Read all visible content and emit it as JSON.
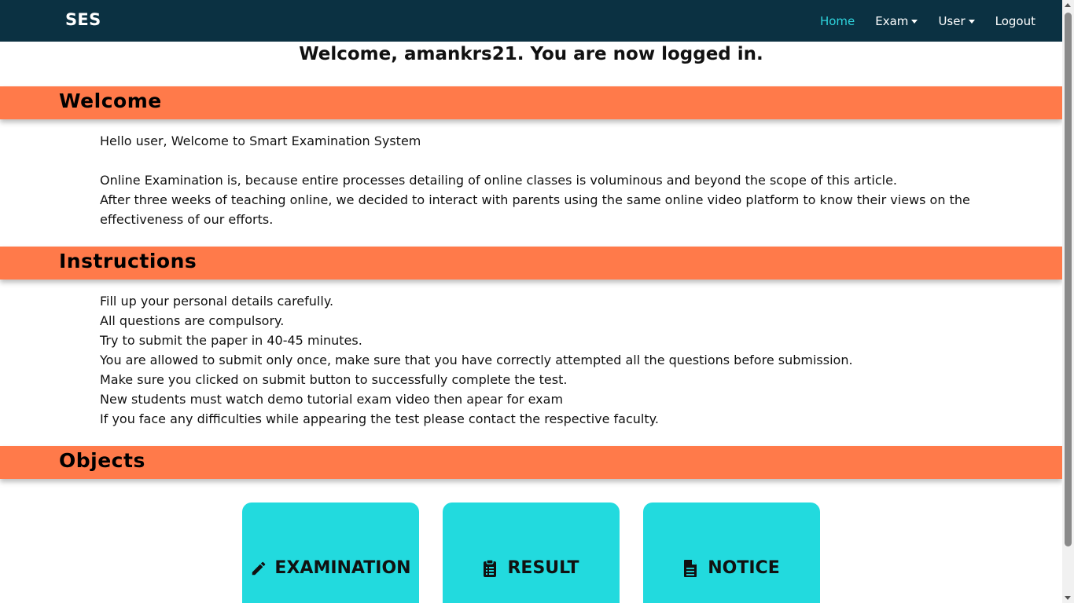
{
  "navbar": {
    "brand": "SES",
    "links": [
      {
        "label": "Home",
        "active": true
      },
      {
        "label": "Exam",
        "dropdown": true
      },
      {
        "label": "User",
        "dropdown": true
      },
      {
        "label": "Logout"
      }
    ]
  },
  "welcome_message": "Welcome, amankrs21. You are now logged in.",
  "sections": {
    "welcome": {
      "title": "Welcome",
      "lines": [
        "Hello user, Welcome to Smart Examination System",
        "",
        "Online Examination is, because entire processes detailing of online classes is voluminous and beyond the scope of this article.",
        "After three weeks of teaching online, we decided to interact with parents using the same online video platform to know their views on the effectiveness of our efforts."
      ]
    },
    "instructions": {
      "title": "Instructions",
      "lines": [
        "Fill up your personal details carefully.",
        "All questions are compulsory.",
        "Try to submit the paper in 40-45 minutes.",
        "You are allowed to submit only once, make sure that you have correctly attempted all the questions before submission.",
        "Make sure you clicked on submit button to successfully complete the test.",
        "New students must watch demo tutorial exam video then apear for exam",
        "If you face any difficulties while appearing the test please contact the respective faculty."
      ]
    },
    "objects": {
      "title": "Objects"
    }
  },
  "cards": [
    {
      "label": "EXAMINATION",
      "icon": "pencil-icon"
    },
    {
      "label": "RESULT",
      "icon": "clipboard-list-icon"
    },
    {
      "label": "NOTICE",
      "icon": "file-text-icon"
    }
  ],
  "colors": {
    "navbar_bg": "#0b3142",
    "nav_active": "#2ed3dc",
    "section_bar": "#ff7a4a",
    "card_bg": "#22dade"
  }
}
